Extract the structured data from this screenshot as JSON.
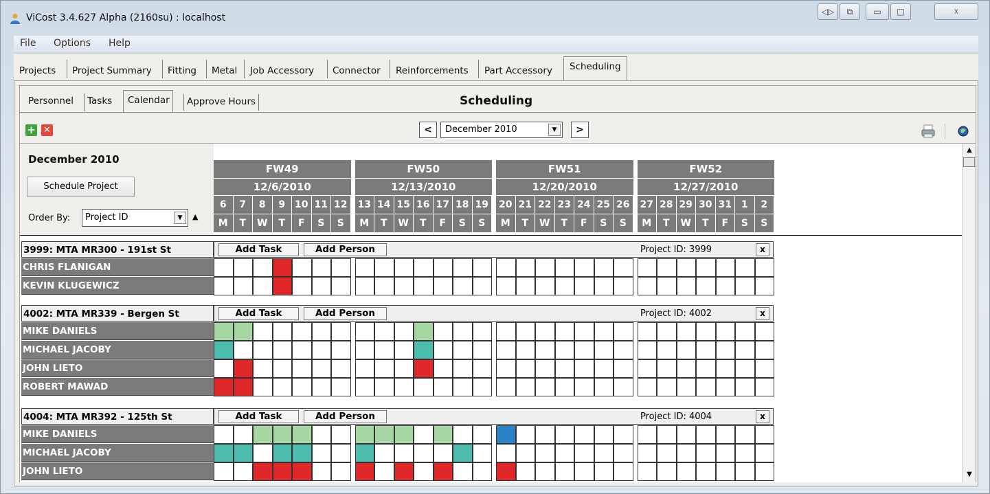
{
  "window": {
    "title": "ViCost  3.4.627 Alpha (2160su) : localhost",
    "buttons": [
      "restore-split",
      "restore-down",
      "minimize",
      "maximize",
      "close"
    ]
  },
  "menu": [
    "File",
    "Options",
    "Help"
  ],
  "main_tabs": [
    "Projects",
    "Project Summary",
    "Fitting",
    "Metal",
    "Job Accessory",
    "Connector",
    "Reinforcements",
    "Part Accessory",
    "Scheduling"
  ],
  "active_main_tab": "Scheduling",
  "sub_tabs": [
    "Personnel",
    "Tasks",
    "Calendar",
    "Approve Hours"
  ],
  "active_sub_tab": "Calendar",
  "page_title": "Scheduling",
  "toolbar": {
    "prev": "<",
    "next": ">",
    "month": "December 2010"
  },
  "left": {
    "month_title": "December 2010",
    "schedule_button": "Schedule Project",
    "order_by_label": "Order By:",
    "order_by_value": "Project ID",
    "sort_indicator": "▲"
  },
  "weeks": [
    {
      "fw": "FW49",
      "date": "12/6/2010",
      "days": [
        "6",
        "7",
        "8",
        "9",
        "10",
        "11",
        "12"
      ]
    },
    {
      "fw": "FW50",
      "date": "12/13/2010",
      "days": [
        "13",
        "14",
        "15",
        "16",
        "17",
        "18",
        "19"
      ]
    },
    {
      "fw": "FW51",
      "date": "12/20/2010",
      "days": [
        "20",
        "21",
        "22",
        "23",
        "24",
        "25",
        "26"
      ]
    },
    {
      "fw": "FW52",
      "date": "12/27/2010",
      "days": [
        "27",
        "28",
        "29",
        "30",
        "31",
        "1",
        "2"
      ]
    }
  ],
  "weekdays": [
    "M",
    "T",
    "W",
    "T",
    "F",
    "S",
    "S"
  ],
  "colors": {
    "red": "#e0282a",
    "green": "#a6d6a2",
    "teal": "#4fbcb0",
    "blue": "#2a83c4",
    "header": "#7d7b7a"
  },
  "projects": [
    {
      "name": "3999: MTA MR300 - 191st St",
      "add_task": "Add Task",
      "add_person": "Add Person",
      "id_label": "Project ID: 3999",
      "close": "x",
      "people": [
        {
          "name": "CHRIS FLANIGAN",
          "cells": {
            "3": "red"
          }
        },
        {
          "name": "KEVIN KLUGEWICZ",
          "cells": {
            "3": "red"
          }
        }
      ]
    },
    {
      "name": "4002: MTA MR339 - Bergen St",
      "add_task": "Add Task",
      "add_person": "Add Person",
      "id_label": "Project ID: 4002",
      "close": "x",
      "people": [
        {
          "name": "MIKE DANIELS",
          "cells": {
            "0": "green",
            "1": "green",
            "10": "green"
          }
        },
        {
          "name": "MICHAEL JACOBY",
          "cells": {
            "0": "teal",
            "10": "teal"
          }
        },
        {
          "name": "JOHN LIETO",
          "cells": {
            "1": "red",
            "10": "red"
          }
        },
        {
          "name": "ROBERT MAWAD",
          "cells": {
            "0": "red",
            "1": "red"
          }
        }
      ]
    },
    {
      "name": "4004: MTA MR392 - 125th St",
      "add_task": "Add Task",
      "add_person": "Add Person",
      "id_label": "Project ID: 4004",
      "close": "x",
      "people": [
        {
          "name": "MIKE DANIELS",
          "cells": {
            "2": "green",
            "3": "green",
            "4": "green",
            "7": "green",
            "8": "green",
            "9": "green",
            "11": "green",
            "14": "blue"
          }
        },
        {
          "name": "MICHAEL JACOBY",
          "cells": {
            "0": "teal",
            "1": "teal",
            "3": "teal",
            "4": "teal",
            "7": "teal",
            "12": "teal"
          }
        },
        {
          "name": "JOHN LIETO",
          "cells": {
            "2": "red",
            "3": "red",
            "4": "red",
            "7": "red",
            "9": "red",
            "11": "red",
            "14": "red"
          }
        }
      ]
    }
  ]
}
